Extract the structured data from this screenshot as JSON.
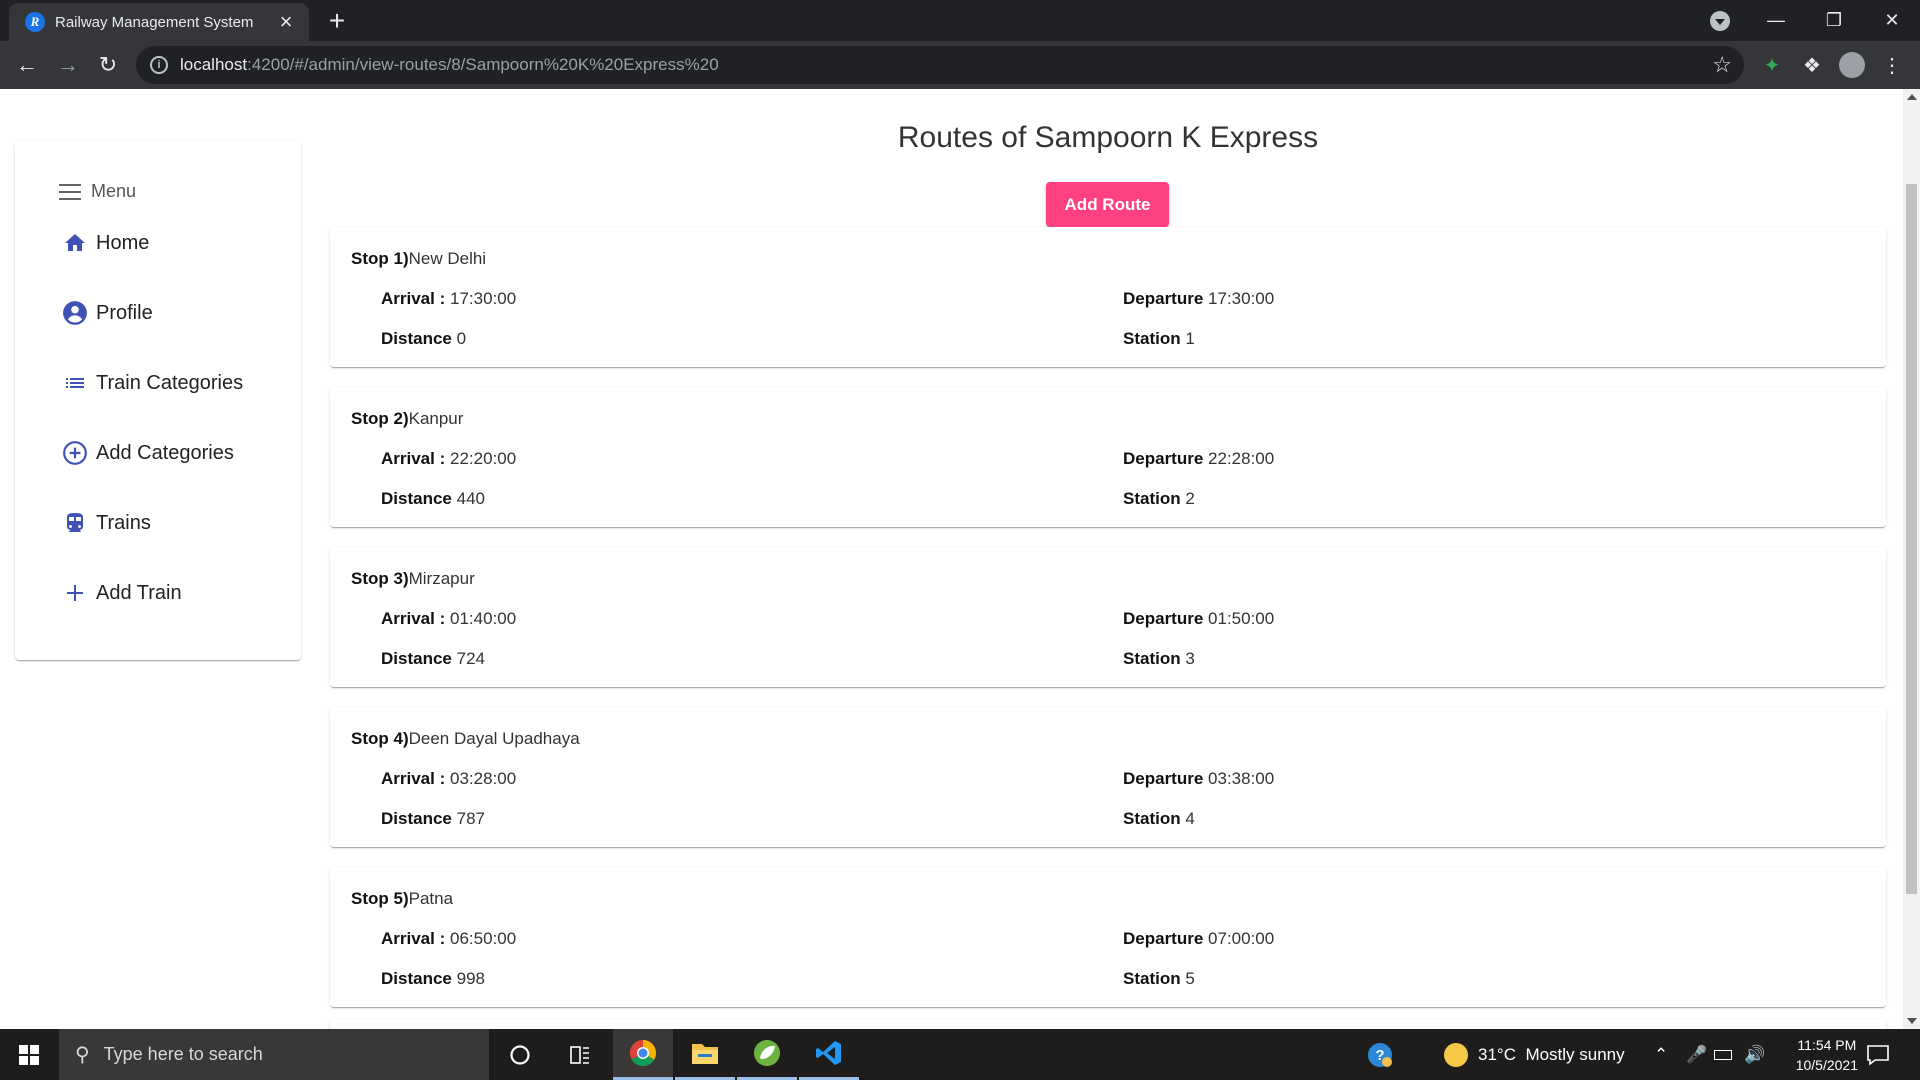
{
  "browser": {
    "tab_title": "Railway Management System",
    "tab_favicon_letter": "R",
    "url_host": "localhost",
    "url_path": ":4200/#/admin/view-routes/8/Sampoorn%20K%20Express%20"
  },
  "sidebar": {
    "menu_label": "Menu",
    "items": [
      {
        "label": "Home",
        "icon": "home-icon"
      },
      {
        "label": "Profile",
        "icon": "account-circle-icon"
      },
      {
        "label": "Train Categories",
        "icon": "list-icon"
      },
      {
        "label": "Add Categories",
        "icon": "add-circle-icon"
      },
      {
        "label": "Trains",
        "icon": "train-icon"
      },
      {
        "label": "Add Train",
        "icon": "plus-icon"
      }
    ]
  },
  "main": {
    "title": "Routes of Sampoorn K Express",
    "add_route_label": "Add Route",
    "labels": {
      "arrival": "Arrival :",
      "departure": "Departure",
      "distance": "Distance",
      "station": "Station"
    },
    "routes": [
      {
        "stop_label": "Stop 1)",
        "name": "New Delhi",
        "arrival": "17:30:00",
        "departure": "17:30:00",
        "distance": "0",
        "station": "1"
      },
      {
        "stop_label": "Stop 2)",
        "name": "Kanpur",
        "arrival": "22:20:00",
        "departure": "22:28:00",
        "distance": "440",
        "station": "2"
      },
      {
        "stop_label": "Stop 3)",
        "name": "Mirzapur",
        "arrival": "01:40:00",
        "departure": "01:50:00",
        "distance": "724",
        "station": "3"
      },
      {
        "stop_label": "Stop 4)",
        "name": "Deen Dayal Upadhaya",
        "arrival": "03:28:00",
        "departure": "03:38:00",
        "distance": "787",
        "station": "4"
      },
      {
        "stop_label": "Stop 5)",
        "name": "Patna",
        "arrival": "06:50:00",
        "departure": "07:00:00",
        "distance": "998",
        "station": "5"
      }
    ]
  },
  "taskbar": {
    "search_placeholder": "Type here to search",
    "weather_temp": "31°C",
    "weather_text": "Mostly sunny",
    "time": "11:54 PM",
    "date": "10/5/2021"
  },
  "colors": {
    "accent_pink": "#ff4081",
    "icon_indigo": "#3f51b5"
  }
}
